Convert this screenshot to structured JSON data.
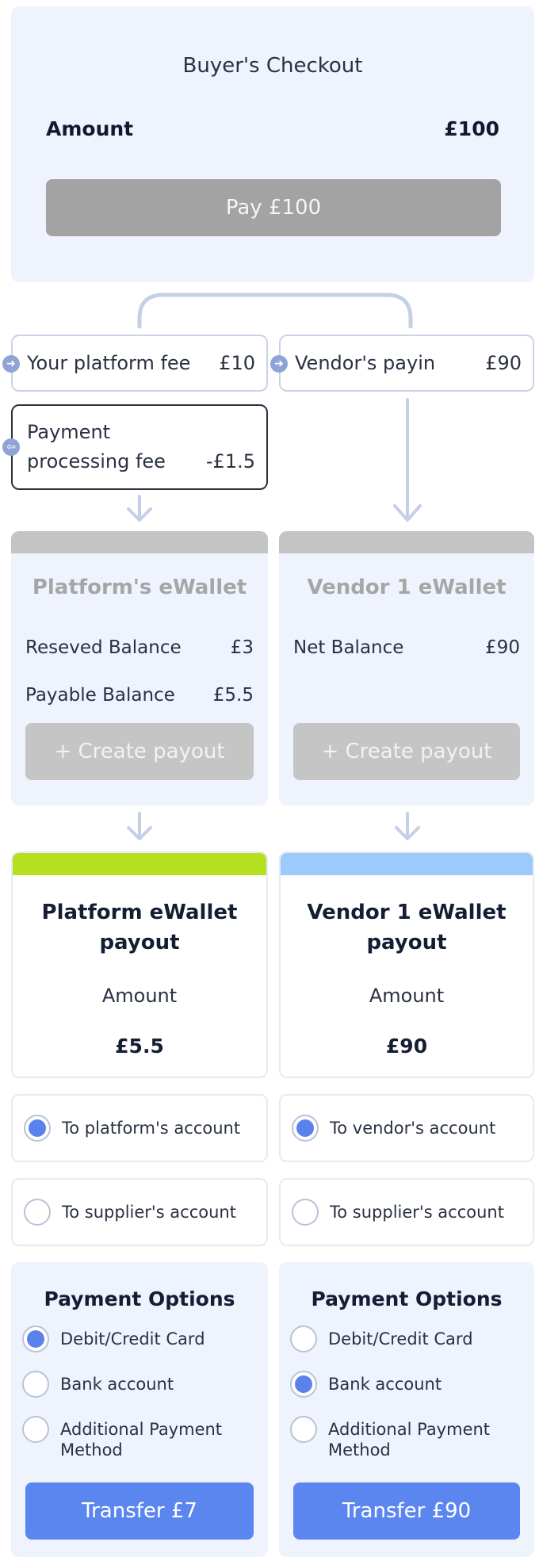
{
  "checkout": {
    "title": "Buyer's Checkout",
    "amount_label": "Amount",
    "amount_value": "£100",
    "pay_button": "Pay £100"
  },
  "split": {
    "platform_fee_label": "Your platform fee",
    "platform_fee_value": "£10",
    "vendor_payin_label": "Vendor's payin",
    "vendor_payin_value": "£90",
    "processing_fee_label_1": "Payment",
    "processing_fee_label_2": "processing fee",
    "processing_fee_value": "-£1.5"
  },
  "platform_wallet": {
    "title": "Platform's eWallet",
    "reserved_label": "Reseved Balance",
    "reserved_value": "£3",
    "payable_label": "Payable Balance",
    "payable_value": "£5.5",
    "create_payout": "+ Create payout"
  },
  "vendor_wallet": {
    "title": "Vendor 1 eWallet",
    "net_label": "Net Balance",
    "net_value": "£90",
    "create_payout": "+ Create payout"
  },
  "platform_payout": {
    "title_1": "Platform eWallet",
    "title_2": "payout",
    "amount_label": "Amount",
    "amount_value": "£5.5",
    "option_own": "To platform's account",
    "option_supplier": "To supplier's account"
  },
  "vendor_payout": {
    "title_1": "Vendor 1 eWallet",
    "title_2": "payout",
    "amount_label": "Amount",
    "amount_value": "£90",
    "option_own": "To vendor's account",
    "option_supplier": "To supplier's account"
  },
  "platform_payment_options": {
    "title": "Payment Options",
    "options": [
      "Debit/Credit Card",
      "Bank account",
      "Additional Payment",
      "Method"
    ],
    "selected": "Debit/Credit Card",
    "transfer_button": "Transfer £7"
  },
  "vendor_payment_options": {
    "title": "Payment Options",
    "options": [
      "Debit/Credit Card",
      "Bank account",
      "Additional Payment",
      "Method"
    ],
    "selected": "Bank account",
    "transfer_button": "Transfer £90"
  },
  "colors": {
    "panel_bg": "#eef3fd",
    "primary": "#5b86f0",
    "platform_accent": "#b5e01f",
    "vendor_accent": "#9ccbfb",
    "disabled_button": "#a3a3a3",
    "connector": "#c4d0e6"
  }
}
